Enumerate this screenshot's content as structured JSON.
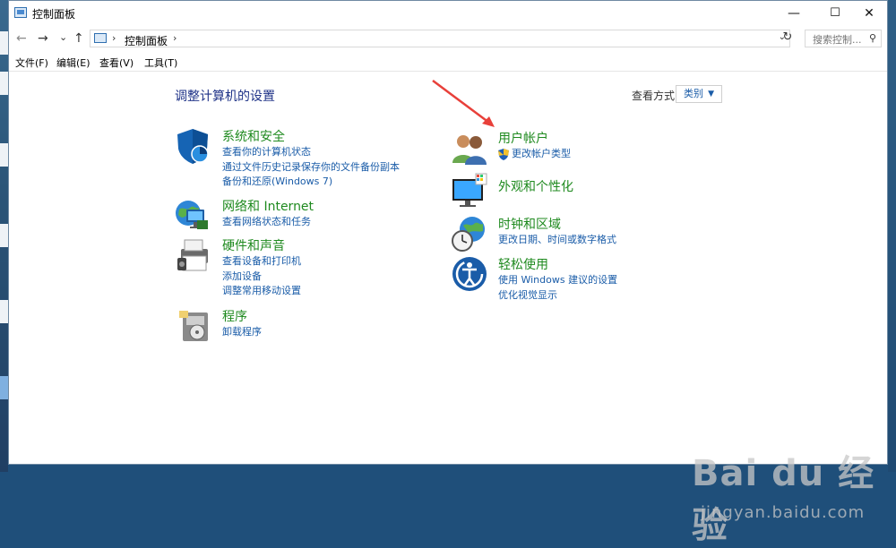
{
  "window": {
    "title": "控制面板",
    "buttons": {
      "minimize": "—",
      "maximize": "☐",
      "close": "✕"
    }
  },
  "address": {
    "breadcrumb": "控制面板",
    "separator": "›",
    "search_placeholder": "搜索控制...",
    "nav": {
      "back": "←",
      "forward": "→",
      "recent": "⌄",
      "up": "↑",
      "refresh": "↻"
    }
  },
  "menu": {
    "file": "文件(F)",
    "edit": "编辑(E)",
    "view": "查看(V)",
    "tools": "工具(T)"
  },
  "main": {
    "title": "调整计算机的设置",
    "view_by_label": "查看方式:",
    "view_by_value": "类别"
  },
  "categories": {
    "system": {
      "title": "系统和安全",
      "links": [
        "查看你的计算机状态",
        "通过文件历史记录保存你的文件备份副本",
        "备份和还原(Windows 7)"
      ]
    },
    "network": {
      "title": "网络和 Internet",
      "links": [
        "查看网络状态和任务"
      ]
    },
    "hardware": {
      "title": "硬件和声音",
      "links": [
        "查看设备和打印机",
        "添加设备",
        "调整常用移动设置"
      ]
    },
    "programs": {
      "title": "程序",
      "links": [
        "卸载程序"
      ]
    },
    "users": {
      "title": "用户帐户",
      "links": [
        "更改帐户类型"
      ]
    },
    "appearance": {
      "title": "外观和个性化",
      "links": []
    },
    "clock": {
      "title": "时钟和区域",
      "links": [
        "更改日期、时间或数字格式"
      ]
    },
    "ease": {
      "title": "轻松使用",
      "links": [
        "使用 Windows 建议的设置",
        "优化视觉显示"
      ]
    }
  },
  "watermark": {
    "brand": "Bai du 经验",
    "url": "jingyan.baidu.com"
  },
  "colors": {
    "link": "#1a5ca8",
    "category": "#1f8a1f",
    "title": "#1e3287",
    "arrow": "#e8403a"
  }
}
